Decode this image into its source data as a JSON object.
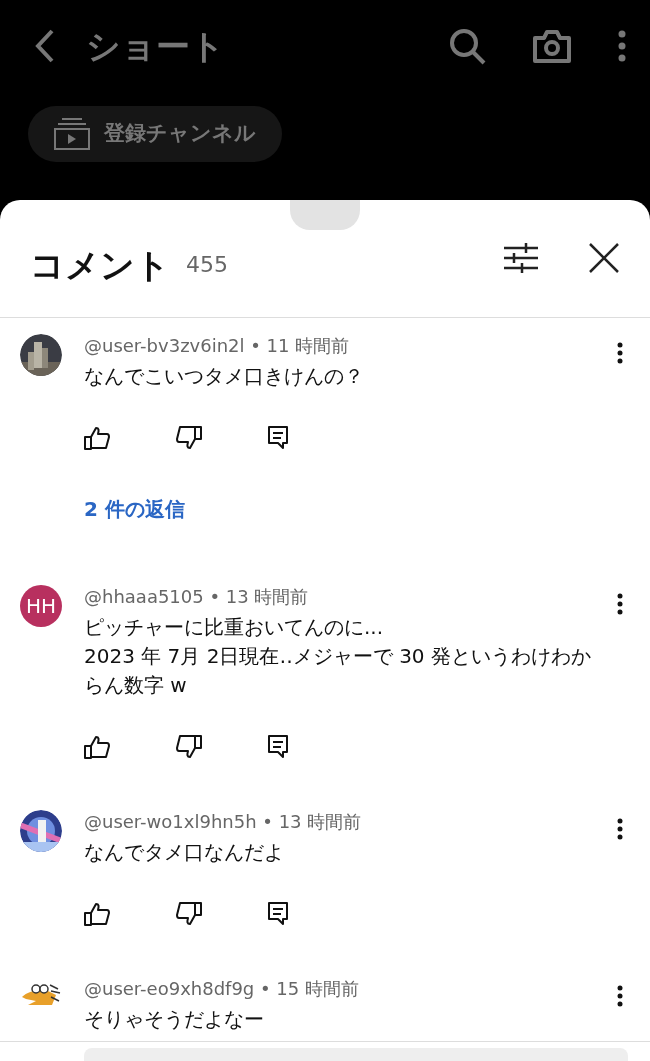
{
  "top_bar": {
    "title": "ショート"
  },
  "chip": {
    "label": "登録チャンネル"
  },
  "comments_sheet": {
    "title": "コメント",
    "count": "455",
    "comments": [
      {
        "author": "@user-bv3zv6in2l",
        "separator": "•",
        "time": "11 時間前",
        "text": "なんでこいつタメ口きけんの？",
        "actions_shown": true,
        "replies": "2 件の返信"
      },
      {
        "avatar": {
          "kind": "initials",
          "initials": "HH",
          "color": "#b8305f"
        },
        "author": "@hhaaa5105",
        "separator": "•",
        "time": "13 時間前",
        "text": "ピッチャーに比重おいてんのに...\n2023 年 7月 2日現在‥メジャーで 30 発というわけわからん数字 w",
        "actions_shown": true
      },
      {
        "author": "@user-wo1xl9hn5h",
        "separator": "•",
        "time": "13 時間前",
        "text": "なんでタメ口なんだよ",
        "actions_shown": true
      },
      {
        "author": "@user-eo9xh8df9g",
        "separator": "•",
        "time": "15 時間前",
        "text": "そりゃそうだよなー",
        "actions_shown": false
      }
    ]
  }
}
